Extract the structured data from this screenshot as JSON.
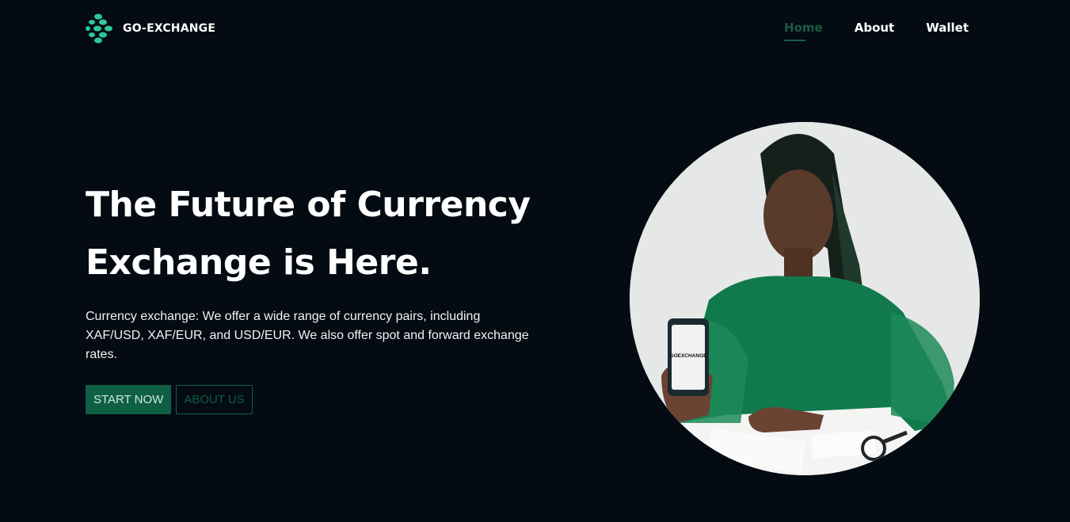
{
  "brand": {
    "name": "GO-EXCHANGE",
    "logo_icon": "dots-logo-icon",
    "accent": "#2fc79a"
  },
  "nav": {
    "items": [
      {
        "label": "Home",
        "active": true
      },
      {
        "label": "About",
        "active": false
      },
      {
        "label": "Wallet",
        "active": false
      }
    ],
    "active_color": "#1c5b43"
  },
  "hero": {
    "title_line1": "The Future of Currency",
    "title_line2": "Exchange is Here.",
    "description": "Currency exchange: We offer a wide range of currency pairs, including XAF/USD, XAF/EUR, and USD/EUR. We also offer spot and forward exchange rates.",
    "primary_button": "START NOW",
    "secondary_button": "ABOUT US"
  },
  "image": {
    "phone_screen_text": "GOEXCHANGE"
  },
  "colors": {
    "background": "#040b12",
    "button_green": "#0f5f45"
  }
}
